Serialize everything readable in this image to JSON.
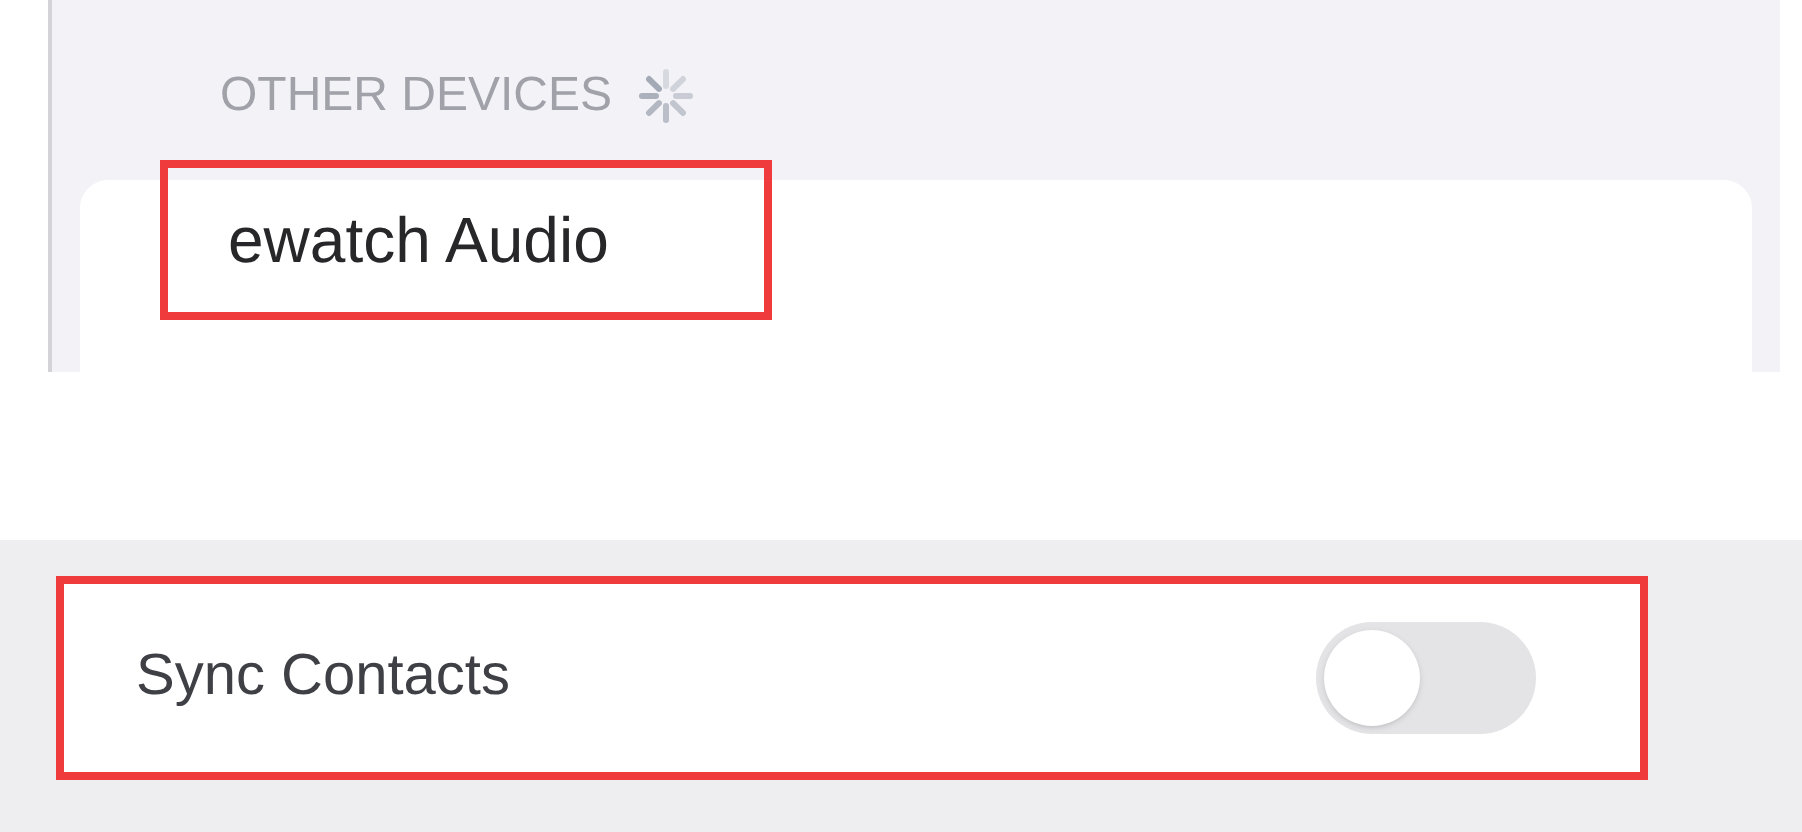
{
  "other_devices": {
    "header": "OTHER DEVICES",
    "loading": true,
    "devices": [
      {
        "name": "ewatch Audio",
        "highlighted": true
      }
    ]
  },
  "settings": [
    {
      "label": "Sync Contacts",
      "on": false,
      "highlighted": true
    }
  ]
}
